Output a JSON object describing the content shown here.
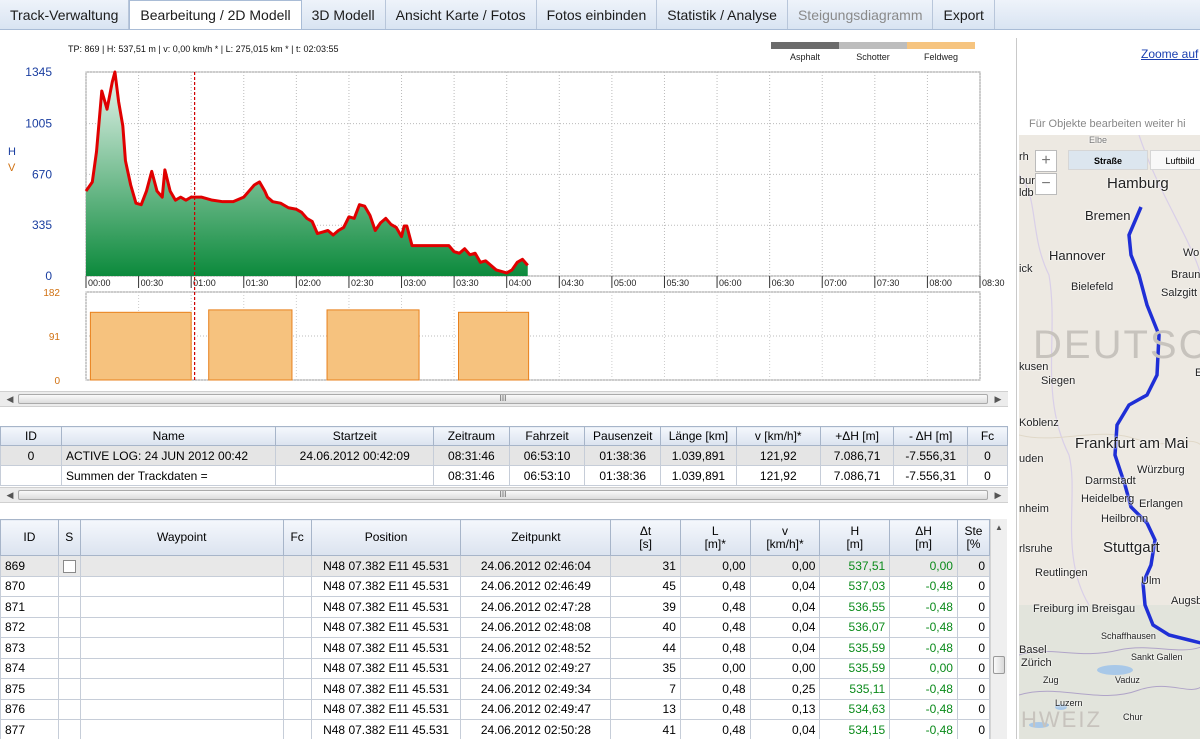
{
  "tabs": [
    {
      "label": "Track-Verwaltung",
      "state": "normal"
    },
    {
      "label": "Bearbeitung / 2D Modell",
      "state": "active"
    },
    {
      "label": "3D Modell",
      "state": "normal"
    },
    {
      "label": "Ansicht Karte / Fotos",
      "state": "normal"
    },
    {
      "label": "Fotos einbinden",
      "state": "normal"
    },
    {
      "label": "Statistik / Analyse",
      "state": "normal"
    },
    {
      "label": "Steigungsdiagramm",
      "state": "disabled"
    },
    {
      "label": "Export",
      "state": "normal"
    }
  ],
  "chart": {
    "info": "TP: 869 | H: 537,51 m | v: 0,00 km/h * | L: 275,015 km * | t: 02:03:55",
    "axis_letters": [
      "H",
      "V"
    ],
    "legend": [
      {
        "label": "Asphalt",
        "color": "#6b6b6b"
      },
      {
        "label": "Schotter",
        "color": "#bdbdbd"
      },
      {
        "label": "Feldweg",
        "color": "#f6c47f"
      }
    ],
    "colors": {
      "profile_line": "#e00000",
      "fill_top": "#e8f5ee",
      "fill_bottom": "#0c8a3c",
      "speed_fill": "#f6c27e",
      "speed_line": "#e8801c",
      "cursor": "#d00000"
    }
  },
  "chart_data": [
    {
      "type": "area",
      "x_ticks": [
        "00:00",
        "00:30",
        "01:00",
        "01:30",
        "02:00",
        "02:30",
        "03:00",
        "03:30",
        "04:00",
        "04:30",
        "05:00",
        "05:30",
        "06:00",
        "06:30",
        "07:00",
        "07:30",
        "08:00",
        "08:30"
      ],
      "y_ticks": [
        "0",
        "335",
        "670",
        "1005",
        "1345"
      ],
      "ylim": [
        0,
        1345
      ],
      "cursor_x": "02:03:55",
      "series": [
        {
          "x": [
            0,
            0.12,
            0.2,
            0.3,
            0.4,
            0.5,
            0.55,
            0.62,
            0.7,
            0.75,
            0.85,
            0.95,
            1.05,
            1.15,
            1.25,
            1.35,
            1.45,
            1.5,
            1.6,
            1.7,
            1.8,
            1.9,
            2.0,
            2.1,
            2.2,
            2.4,
            2.6,
            2.8,
            3.0,
            3.1,
            3.2,
            3.3,
            3.4,
            3.45,
            3.55,
            3.7,
            3.85,
            4.0,
            4.1,
            4.2,
            4.3,
            4.4,
            4.5,
            4.6,
            4.7,
            4.8,
            4.9,
            5.0,
            5.1,
            5.2,
            5.3,
            5.4,
            5.5,
            5.6,
            5.7,
            5.8,
            5.9,
            6.0,
            6.05,
            6.1,
            6.2,
            6.3,
            6.4,
            6.5,
            6.7,
            6.9,
            7.0,
            7.1,
            7.2,
            7.3,
            7.4,
            7.5,
            7.6,
            7.7,
            7.8,
            7.9,
            8.0,
            8.1,
            8.2,
            8.3,
            8.4
          ],
          "values": [
            560,
            620,
            820,
            1220,
            1100,
            1280,
            1345,
            1150,
            990,
            760,
            600,
            480,
            470,
            560,
            690,
            560,
            520,
            700,
            560,
            500,
            520,
            500,
            520,
            520,
            520,
            500,
            490,
            490,
            520,
            560,
            600,
            620,
            560,
            520,
            490,
            480,
            450,
            440,
            420,
            380,
            360,
            280,
            290,
            300,
            270,
            300,
            320,
            390,
            380,
            470,
            460,
            400,
            300,
            350,
            380,
            340,
            320,
            260,
            330,
            330,
            200,
            200,
            200,
            200,
            200,
            200,
            160,
            150,
            180,
            140,
            150,
            90,
            100,
            70,
            40,
            30,
            20,
            40,
            90,
            110,
            70
          ]
        }
      ]
    },
    {
      "type": "area",
      "y_ticks": [
        "0",
        "91",
        "182"
      ],
      "ylim": [
        0,
        182
      ],
      "segments": [
        {
          "start": "00:05",
          "end": "02:00",
          "level": 140
        },
        {
          "start": "02:20",
          "end": "03:55",
          "level": 145
        },
        {
          "start": "04:35",
          "end": "06:20",
          "level": 145
        },
        {
          "start": "07:05",
          "end": "08:25",
          "level": 140
        }
      ]
    }
  ],
  "scrollbar_label": "III",
  "track_table": {
    "headers": [
      "ID",
      "Name",
      "Startzeit",
      "Zeitraum",
      "Fahrzeit",
      "Pausenzeit",
      "Länge [km]",
      "v [km/h]*",
      "+ΔH [m]",
      "- ΔH [m]",
      "Fc"
    ],
    "rows": [
      [
        "0",
        "ACTIVE LOG: 24 JUN 2012 00:42",
        "24.06.2012 00:42:09",
        "08:31:46",
        "06:53:10",
        "01:38:36",
        "1.039,891",
        "121,92",
        "7.086,71",
        "-7.556,31",
        "0"
      ],
      [
        "",
        "Summen der Trackdaten =",
        "",
        "08:31:46",
        "06:53:10",
        "01:38:36",
        "1.039,891",
        "121,92",
        "7.086,71",
        "-7.556,31",
        "0"
      ]
    ]
  },
  "waypoint_table": {
    "headers": [
      [
        "ID",
        ""
      ],
      [
        "S",
        ""
      ],
      [
        "Waypoint",
        ""
      ],
      [
        "Fc",
        ""
      ],
      [
        "Position",
        ""
      ],
      [
        "Zeitpunkt",
        ""
      ],
      [
        "Δt",
        "[s]"
      ],
      [
        "L",
        "[m]*"
      ],
      [
        "v",
        "[km/h]*"
      ],
      [
        "H",
        "[m]"
      ],
      [
        "ΔH",
        "[m]"
      ],
      [
        "Ste",
        "[%"
      ]
    ],
    "rows": [
      [
        "869",
        "",
        "",
        "",
        "N48 07.382 E11 45.531",
        "24.06.2012 02:46:04",
        "31",
        "0,00",
        "0,00",
        "537,51",
        "0,00",
        "0"
      ],
      [
        "870",
        "",
        "",
        "",
        "N48 07.382 E11 45.531",
        "24.06.2012 02:46:49",
        "45",
        "0,48",
        "0,04",
        "537,03",
        "-0,48",
        "0"
      ],
      [
        "871",
        "",
        "",
        "",
        "N48 07.382 E11 45.531",
        "24.06.2012 02:47:28",
        "39",
        "0,48",
        "0,04",
        "536,55",
        "-0,48",
        "0"
      ],
      [
        "872",
        "",
        "",
        "",
        "N48 07.382 E11 45.531",
        "24.06.2012 02:48:08",
        "40",
        "0,48",
        "0,04",
        "536,07",
        "-0,48",
        "0"
      ],
      [
        "873",
        "",
        "",
        "",
        "N48 07.382 E11 45.531",
        "24.06.2012 02:48:52",
        "44",
        "0,48",
        "0,04",
        "535,59",
        "-0,48",
        "0"
      ],
      [
        "874",
        "",
        "",
        "",
        "N48 07.382 E11 45.531",
        "24.06.2012 02:49:27",
        "35",
        "0,00",
        "0,00",
        "535,59",
        "0,00",
        "0"
      ],
      [
        "875",
        "",
        "",
        "",
        "N48 07.382 E11 45.531",
        "24.06.2012 02:49:34",
        "7",
        "0,48",
        "0,25",
        "535,11",
        "-0,48",
        "0"
      ],
      [
        "876",
        "",
        "",
        "",
        "N48 07.382 E11 45.531",
        "24.06.2012 02:49:47",
        "13",
        "0,48",
        "0,13",
        "534,63",
        "-0,48",
        "0"
      ],
      [
        "877",
        "",
        "",
        "",
        "N48 07.382 E11 45.531",
        "24.06.2012 02:50:28",
        "41",
        "0,48",
        "0,04",
        "534,15",
        "-0,48",
        "0"
      ]
    ]
  },
  "map": {
    "zoom_link": "Zoome auf",
    "hint": "Für Objekte bearbeiten weiter hi",
    "map_types": [
      "Straße",
      "Luftbild"
    ],
    "country_label": "DEUTSCH",
    "country_label_south": "HWEIZ",
    "cities": [
      "Elbe",
      "Hamburg",
      "Bremen",
      "Hannover",
      "Wo",
      "Braun",
      "Bielefeld",
      "Salzgitt",
      "Siegen",
      "kusen",
      "Koblenz",
      "Frankfurt am Mai",
      "Würzburg",
      "Darmstadt",
      "Heidelberg",
      "Erlangen",
      "Heilbronn",
      "Stuttgart",
      "Reutlingen",
      "Ulm",
      "Augsbu",
      "Freiburg im Breisgau",
      "Schaffhausen",
      "Basel",
      "Zürich",
      "Sankt Gallen",
      "Zug",
      "Vaduz",
      "Luzern",
      "Chur",
      "rlsruhe",
      "nheim",
      "uden",
      "ick",
      "rh",
      "bur",
      "ldb",
      "E"
    ],
    "route_color": "#1f2fd6"
  }
}
